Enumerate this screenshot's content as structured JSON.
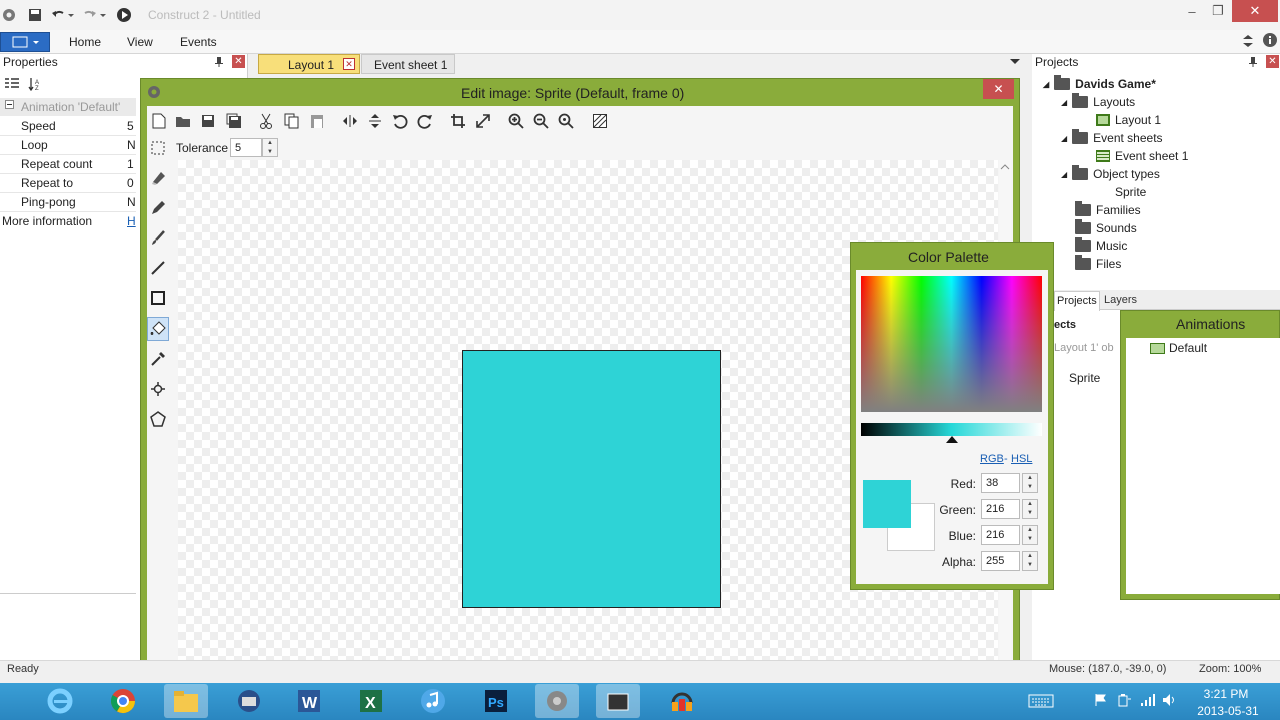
{
  "window": {
    "title": "Construct 2 - Untitled",
    "minimize": "–",
    "maximize": "❐",
    "close": "✕"
  },
  "ribbon": {
    "tabs": [
      "Home",
      "View",
      "Events"
    ]
  },
  "properties": {
    "title": "Properties",
    "section": "Animation 'Default'",
    "rows": [
      {
        "label": "Speed",
        "value": "5"
      },
      {
        "label": "Loop",
        "value": "N"
      },
      {
        "label": "Repeat count",
        "value": "1"
      },
      {
        "label": "Repeat to",
        "value": "0"
      },
      {
        "label": "Ping-pong",
        "value": "N"
      }
    ],
    "more_label": "More information",
    "more_value": "H"
  },
  "tabs": {
    "layout": "Layout 1",
    "event": "Event sheet 1"
  },
  "editor": {
    "title": "Edit image: Sprite (Default, frame 0)",
    "tolerance_label": "Tolerance",
    "tolerance_value": "5",
    "fill_color": "#2ed3d6"
  },
  "projects": {
    "title": "Projects",
    "root": "Davids Game*",
    "layouts": "Layouts",
    "layout_item": "Layout 1",
    "event_sheets": "Event sheets",
    "event_item": "Event sheet 1",
    "object_types": "Object types",
    "object_item": "Sprite",
    "families": "Families",
    "sounds": "Sounds",
    "music": "Music",
    "files": "Files",
    "tab_projects": "Projects",
    "tab_layers": "Layers",
    "objects_header": "ects",
    "objects_sub": "Layout 1' ob",
    "objects_item": "Sprite"
  },
  "palette": {
    "title": "Color Palette",
    "mode_rgb": "RGB",
    "mode_sep": "-",
    "mode_hsl": "HSL",
    "red_label": "Red:",
    "red": "38",
    "green_label": "Green:",
    "green": "216",
    "blue_label": "Blue:",
    "blue": "216",
    "alpha_label": "Alpha:",
    "alpha": "255"
  },
  "animations": {
    "title": "Animations",
    "item": "Default"
  },
  "status": {
    "left": "Ready",
    "mouse": "Mouse: (187.0, -39.0, 0)",
    "zoom": "Zoom: 100%"
  },
  "clock": {
    "time": "3:21 PM",
    "date": "2013-05-31"
  },
  "taskbar_apps": [
    "internet-explorer",
    "chrome",
    "file-explorer",
    "thunderbird",
    "word",
    "excel",
    "itunes",
    "photoshop",
    "construct",
    "video",
    "audacity"
  ]
}
